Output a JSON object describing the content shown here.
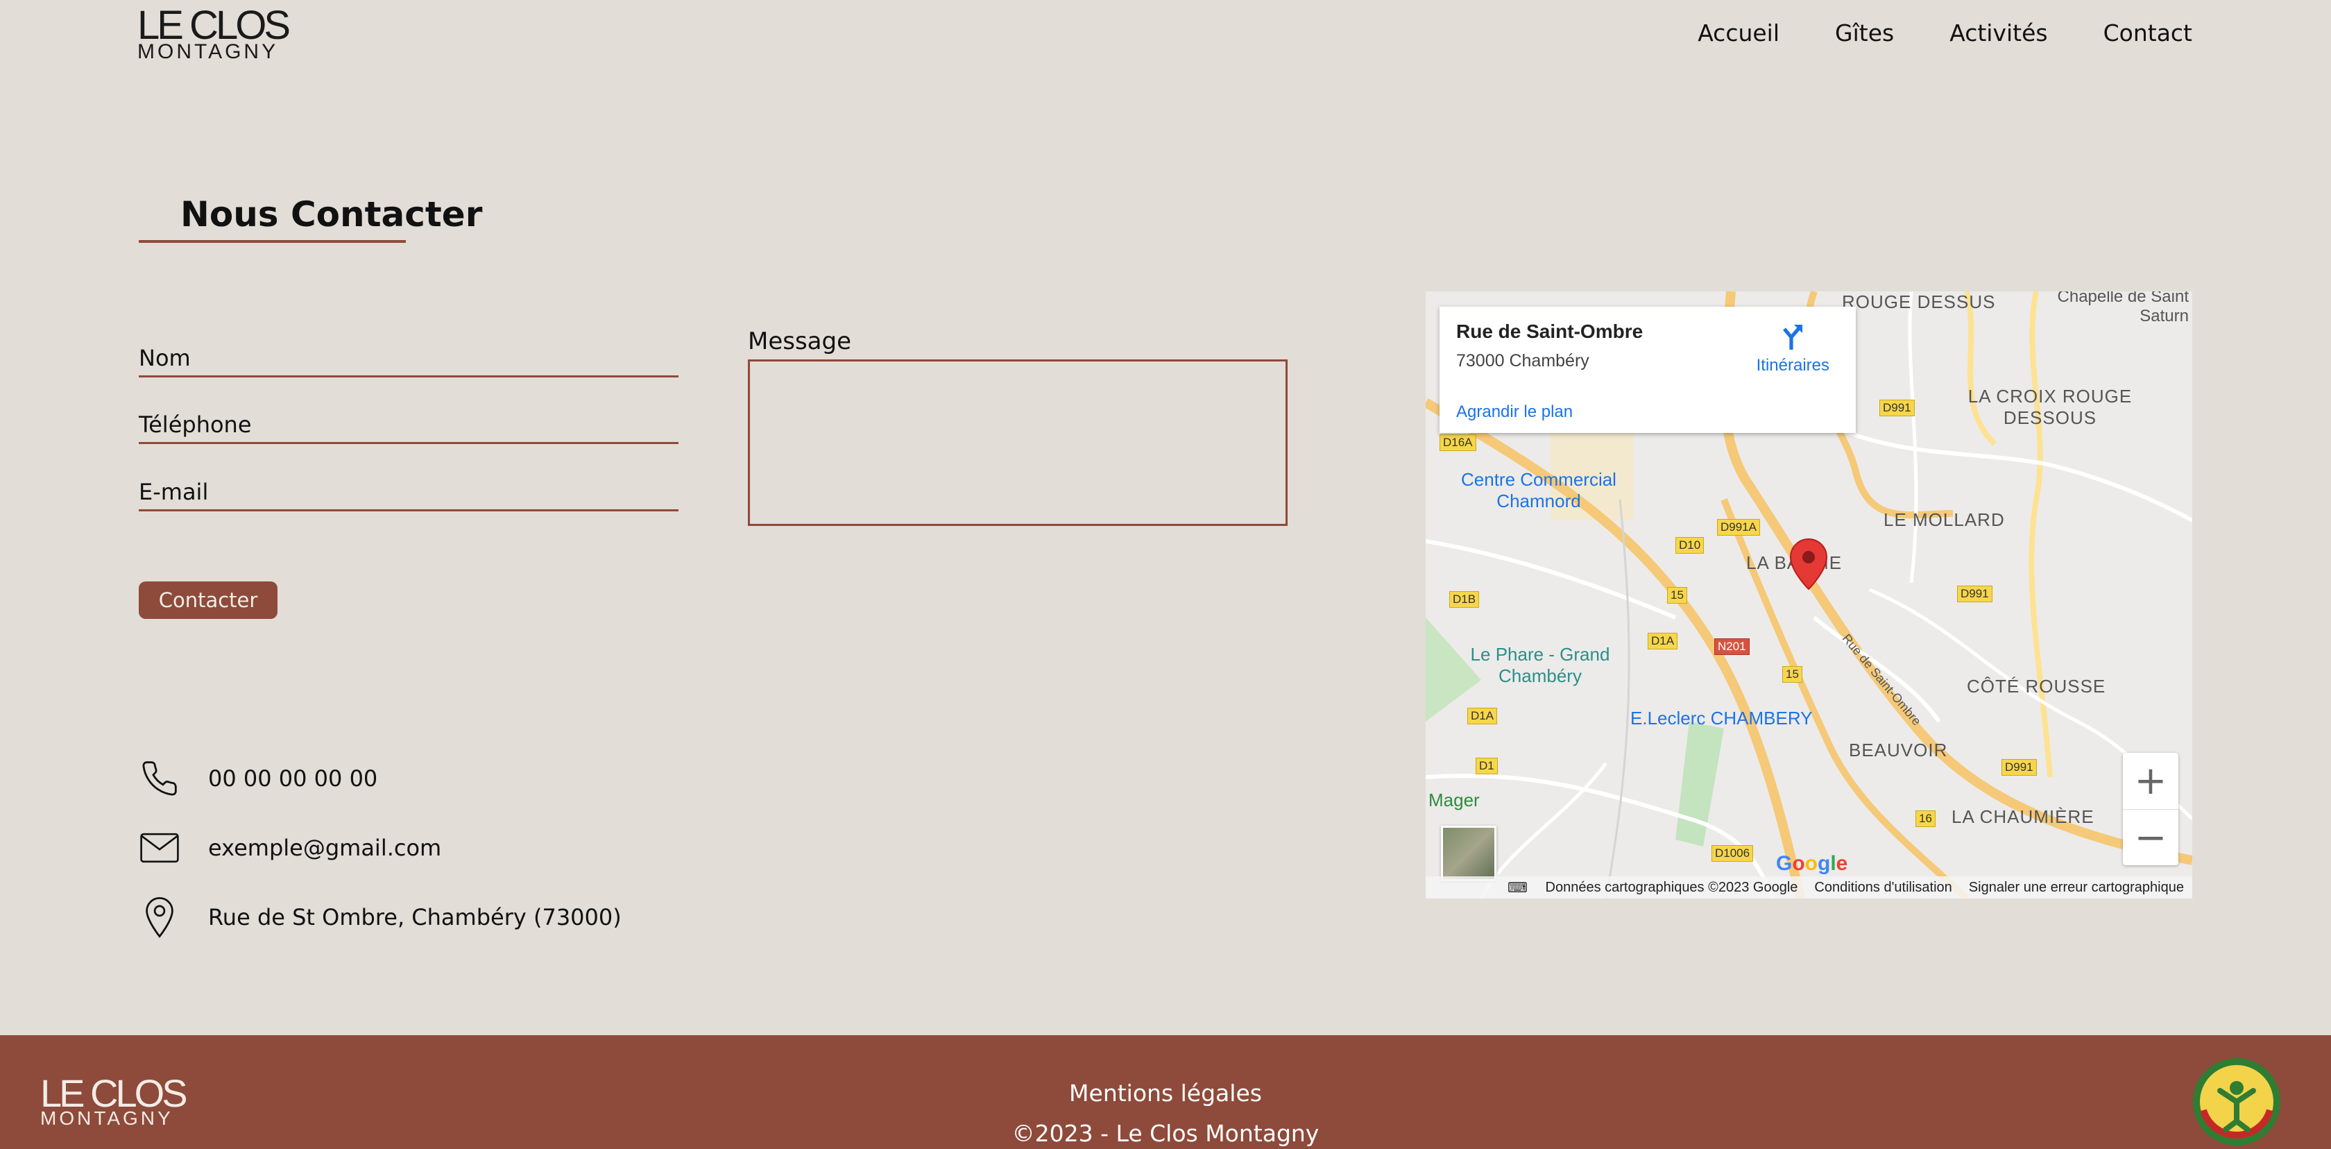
{
  "header": {
    "logo_line1": "LE CLOS",
    "logo_line2": "MONTAGNY",
    "nav": [
      "Accueil",
      "Gîtes",
      "Activités",
      "Contact"
    ]
  },
  "page_title": "Nous Contacter",
  "form": {
    "name_label": "Nom",
    "phone_label": "Téléphone",
    "email_label": "E-mail",
    "message_label": "Message",
    "submit_label": "Contacter"
  },
  "contact_info": {
    "phone": "00 00 00 00 00",
    "email": "exemple@gmail.com",
    "address": "Rue de St Ombre, Chambéry (73000)"
  },
  "map": {
    "card_title": "Rue de Saint-Ombre",
    "card_address": "73000 Chambéry",
    "directions_label": "Itinéraires",
    "enlarge_label": "Agrandir le plan",
    "labels": {
      "rouge_dessus": "ROUGE DESSUS",
      "chapelle": "Chapelle de Saint Saturn",
      "croix": "LA CROIX ROUGE DESSOUS",
      "mollard": "LE MOLLARD",
      "baume": "LA BAUME",
      "cote_rousse": "CÔTÉ ROUSSE",
      "beauvoir": "BEAUVOIR",
      "chaumiere": "LA CHAUMIÈRE",
      "chamnord": "Centre Commercial Chamnord",
      "phare": "Le Phare - Grand Chambéry",
      "leclerc": "E.Leclerc CHAMBERY",
      "mager": "Mager",
      "rue_saint_ombre": "Rue de Saint-Ombre"
    },
    "roads": [
      "D16A",
      "D991A",
      "D10",
      "D1B",
      "15",
      "D1A",
      "N201",
      "15",
      "D1A",
      "D991",
      "D991",
      "D991",
      "D1",
      "D1006",
      "16"
    ],
    "footer": {
      "data": "Données cartographiques ©2023 Google",
      "terms": "Conditions d'utilisation",
      "report": "Signaler une erreur cartographique"
    },
    "google_label": "Google"
  },
  "footer": {
    "logo_line1": "LE CLOS",
    "logo_line2": "MONTAGNY",
    "legal": "Mentions légales",
    "copyright": "©2023 - Le Clos Montagny"
  },
  "colors": {
    "background": "#e2ddd7",
    "accent": "#8e4a3a"
  }
}
